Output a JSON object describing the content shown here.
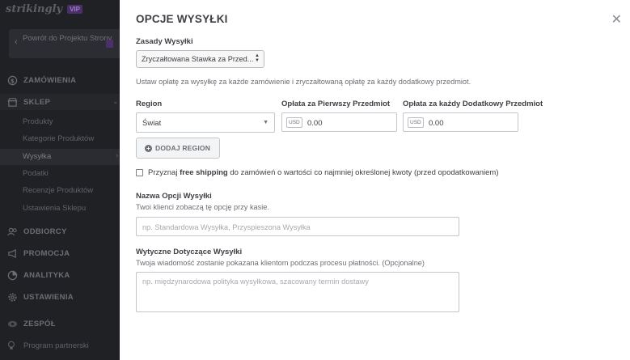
{
  "sidebar": {
    "brand": "strikingly",
    "vip_badge": "VIP",
    "back_label": "Powrót do Projektu Strony",
    "items": [
      {
        "label": "ZAMÓWIENIA",
        "icon": "dollar-icon"
      },
      {
        "label": "SKLEP",
        "icon": "store-icon"
      },
      {
        "label": "ODBIORCY",
        "icon": "users-icon"
      },
      {
        "label": "PROMOCJA",
        "icon": "megaphone-icon"
      },
      {
        "label": "ANALITYKA",
        "icon": "analytics-icon"
      },
      {
        "label": "USTAWIENIA",
        "icon": "gear-icon"
      },
      {
        "label": "ZESPÓŁ",
        "icon": "team-icon"
      }
    ],
    "shop_subitems": [
      "Produkty",
      "Kategorie Produktów",
      "Wysyłka",
      "Podatki",
      "Recenzje Produktów",
      "Ustawienia Sklepu"
    ],
    "partner_label": "Program partnerski"
  },
  "modal": {
    "title": "OPCJE WYSYŁKI",
    "close_glyph": "✕",
    "rules_label": "Zasady Wysyłki",
    "rules_value": "Zryczałtowana Stawka za Przed...",
    "rules_help": "Ustaw opłatę za wysyłkę za każde zamówienie i zryczałtowaną opłatę za każdy dodatkowy przedmiot.",
    "region_label": "Region",
    "region_value": "Świat",
    "first_item_label": "Opłata za Pierwszy Przedmiot",
    "additional_item_label": "Opłata za każdy Dodatkowy Przedmiot",
    "currency": "USD",
    "first_item_value": "0.00",
    "additional_item_value": "0.00",
    "add_region_label": "DODAJ REGION",
    "free_shipping_prefix": "Przyznaj ",
    "free_shipping_bold": "free shipping",
    "free_shipping_suffix": " do zamówień o wartości co najmniej określonej kwoty (przed opodatkowaniem)",
    "name_label": "Nazwa Opcji Wysyłki",
    "name_help": "Twoi klienci zobaczą tę opcję przy kasie.",
    "name_placeholder": "np. Standardowa Wysyłka, Przyspieszona Wysyłka",
    "guidelines_label": "Wytyczne Dotyczące Wysyłki",
    "guidelines_help": "Twoja wiadomość zostanie pokazana klientom podczas procesu płatności. (Opcjonalne)",
    "guidelines_placeholder": "np. międzynarodowa polityka wysyłkowa, szacowany termin dostawy"
  }
}
